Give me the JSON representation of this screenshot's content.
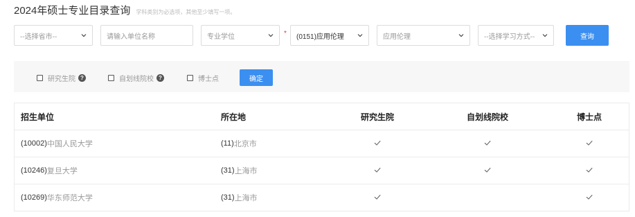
{
  "header": {
    "title": "2024年硕士专业目录查询",
    "hint": "学科类别为必选项，其他至少填写一项。"
  },
  "filters": {
    "province": "--选择省市--",
    "unit_placeholder": "请输入单位名称",
    "degree_type": "专业学位",
    "required_mark": "*",
    "discipline": "(0151)应用伦理",
    "major": "应用伦理",
    "study_mode": "--选择学习方式--",
    "search_label": "查询"
  },
  "options": {
    "graduate_school": "研究生院",
    "self_marking": "自划线院校",
    "doctoral_point": "博士点",
    "help_glyph": "?",
    "confirm_label": "确定"
  },
  "table": {
    "headers": [
      "招生单位",
      "所在地",
      "研究生院",
      "自划线院校",
      "博士点"
    ],
    "rows": [
      {
        "unit_code": "(10002)",
        "unit_name": "中国人民大学",
        "loc_code": "(11)",
        "loc_name": "北京市",
        "graduate_school": true,
        "self_marking": true,
        "doctoral_point": true
      },
      {
        "unit_code": "(10246)",
        "unit_name": "复旦大学",
        "loc_code": "(31)",
        "loc_name": "上海市",
        "graduate_school": true,
        "self_marking": true,
        "doctoral_point": true
      },
      {
        "unit_code": "(10269)",
        "unit_name": "华东师范大学",
        "loc_code": "(31)",
        "loc_name": "上海市",
        "graduate_school": true,
        "self_marking": false,
        "doctoral_point": true
      }
    ]
  },
  "colors": {
    "accent": "#3b8ff0",
    "required": "#e9353f"
  }
}
